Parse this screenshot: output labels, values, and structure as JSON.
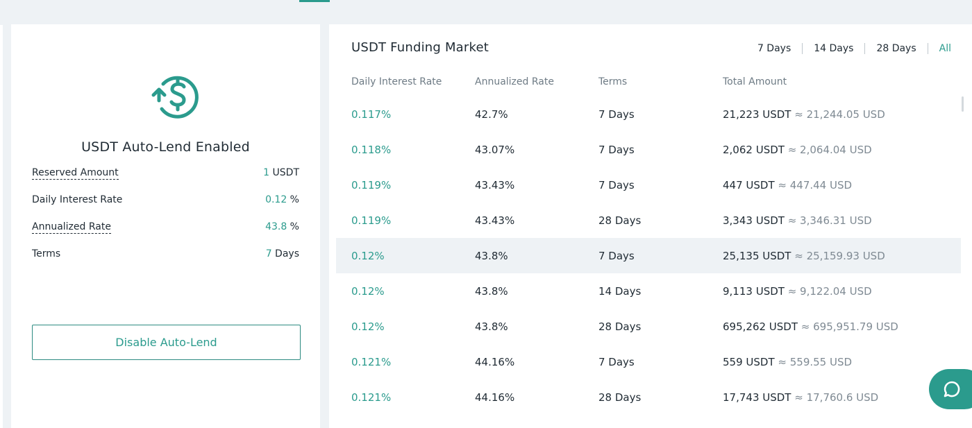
{
  "left_panel": {
    "title": "USDT Auto-Lend Enabled",
    "rows": [
      {
        "label": "Reserved Amount",
        "value_num": "1",
        "value_unit": " USDT"
      },
      {
        "label": "Daily Interest Rate",
        "value_num": "0.12",
        "value_unit": " %"
      },
      {
        "label": "Annualized Rate",
        "value_num": "43.8",
        "value_unit": " %"
      },
      {
        "label": "Terms",
        "value_num": "7",
        "value_unit": " Days"
      }
    ],
    "disable_button": "Disable Auto-Lend"
  },
  "market": {
    "title": "USDT Funding Market",
    "filters": [
      "7 Days",
      "14 Days",
      "28 Days",
      "All"
    ],
    "active_filter": "All",
    "columns": [
      "Daily Interest Rate",
      "Annualized Rate",
      "Terms",
      "Total Amount"
    ],
    "rows": [
      {
        "daily": "0.117%",
        "annual": "42.7%",
        "terms": "7 Days",
        "amount": "21,223 USDT",
        "usd": "≈ 21,244.05 USD"
      },
      {
        "daily": "0.118%",
        "annual": "43.07%",
        "terms": "7 Days",
        "amount": "2,062 USDT",
        "usd": "≈ 2,064.04 USD"
      },
      {
        "daily": "0.119%",
        "annual": "43.43%",
        "terms": "7 Days",
        "amount": "447 USDT",
        "usd": "≈ 447.44 USD"
      },
      {
        "daily": "0.119%",
        "annual": "43.43%",
        "terms": "28 Days",
        "amount": "3,343 USDT",
        "usd": "≈ 3,346.31 USD"
      },
      {
        "daily": "0.12%",
        "annual": "43.8%",
        "terms": "7 Days",
        "amount": "25,135 USDT",
        "usd": "≈ 25,159.93 USD"
      },
      {
        "daily": "0.12%",
        "annual": "43.8%",
        "terms": "14 Days",
        "amount": "9,113 USDT",
        "usd": "≈ 9,122.04 USD"
      },
      {
        "daily": "0.12%",
        "annual": "43.8%",
        "terms": "28 Days",
        "amount": "695,262 USDT",
        "usd": "≈ 695,951.79 USD"
      },
      {
        "daily": "0.121%",
        "annual": "44.16%",
        "terms": "7 Days",
        "amount": "559 USDT",
        "usd": "≈ 559.55 USD"
      },
      {
        "daily": "0.121%",
        "annual": "44.16%",
        "terms": "28 Days",
        "amount": "17,743 USDT",
        "usd": "≈ 17,760.6 USD"
      }
    ],
    "highlighted_row": 4
  },
  "icons": {
    "auto_lend": "dollar-cycle-icon",
    "chat": "chat-bubble-icon"
  },
  "colors": {
    "accent": "#2b9b8d",
    "text": "#1f2a33",
    "muted": "#7f8a93",
    "background": "#eef2f5"
  }
}
